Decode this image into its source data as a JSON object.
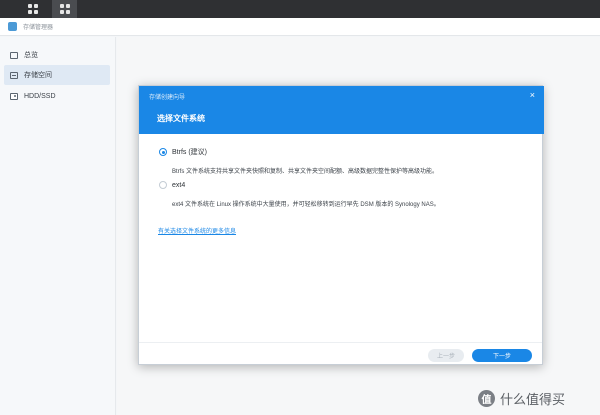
{
  "window": {
    "title": "存储管理器"
  },
  "sidebar": {
    "items": [
      {
        "label": "总览",
        "icon": "overview-icon",
        "active": false
      },
      {
        "label": "存储空间",
        "icon": "storage-icon",
        "active": true
      },
      {
        "label": "HDD/SSD",
        "icon": "hdd-icon",
        "active": false
      }
    ]
  },
  "dialog": {
    "window_title": "存储创建向导",
    "close": "×",
    "heading": "选择文件系统",
    "options": [
      {
        "label": "Btrfs (建议)",
        "selected": true,
        "description": "Btrfs 文件系统支持共享文件夹快照和复制、共享文件夹空间配额、高级数据完整性保护等高级功能。"
      },
      {
        "label": "ext4",
        "selected": false,
        "description": "ext4 文件系统在 Linux 操作系统中大量使用，并可轻松移转到运行早先 DSM 版本的 Synology NAS。"
      }
    ],
    "more_link": "有关选择文件系统的更多信息",
    "buttons": {
      "prev": "上一步",
      "next": "下一步"
    }
  },
  "watermark": {
    "logo": "值",
    "text": "什么值得买"
  },
  "colors": {
    "accent": "#1a87e6",
    "taskbar": "#2f3033"
  }
}
